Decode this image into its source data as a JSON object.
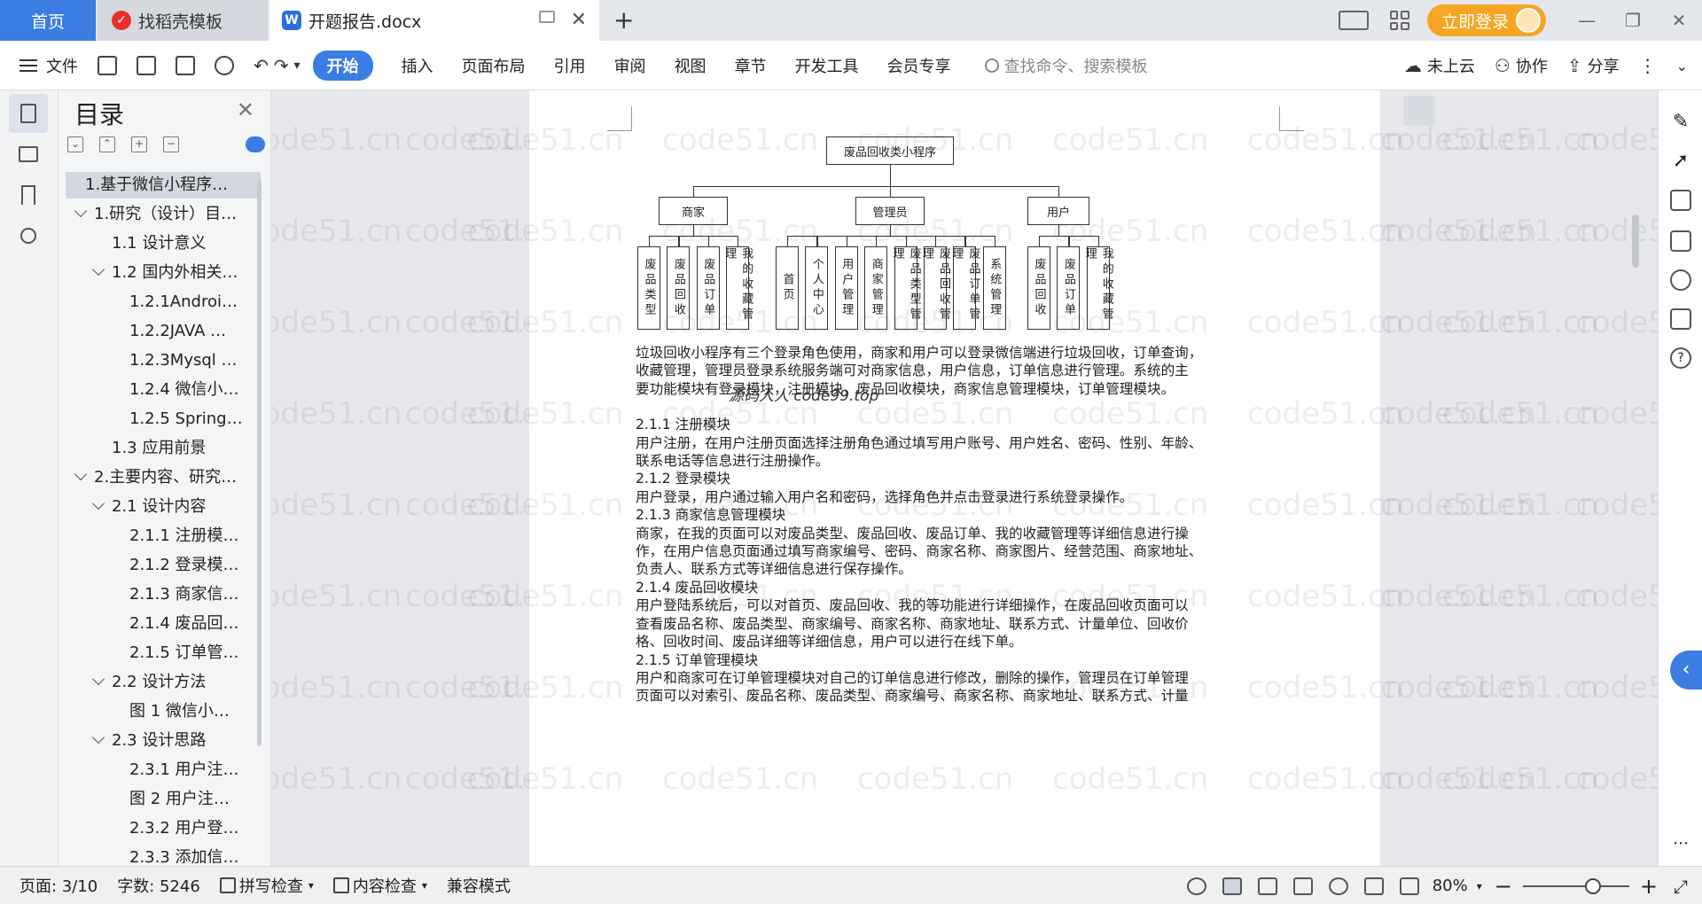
{
  "tabs": {
    "home": "首页",
    "daoke": "找稻壳模板",
    "doc": "开题报告.docx"
  },
  "titlebar": {
    "login": "立即登录"
  },
  "ribbon": {
    "file": "文件",
    "tabs": [
      "开始",
      "插入",
      "页面布局",
      "引用",
      "审阅",
      "视图",
      "章节",
      "开发工具",
      "会员专享"
    ],
    "search_placeholder": "查找命令、搜索模板",
    "cloud": "未上云",
    "collab": "协作",
    "share": "分享"
  },
  "toc": {
    "title": "目录",
    "items": [
      {
        "label": "1.基于微信小程序…",
        "level": 0,
        "caret": false,
        "selected": true
      },
      {
        "label": "1.研究（设计）目…",
        "level": 0,
        "caret": true
      },
      {
        "label": "1.1 设计意义",
        "level": 1,
        "caret": false
      },
      {
        "label": "1.2 国内外相关…",
        "level": 1,
        "caret": true
      },
      {
        "label": "1.2.1Androi…",
        "level": 2,
        "caret": false
      },
      {
        "label": "1.2.2JAVA …",
        "level": 2,
        "caret": false
      },
      {
        "label": "1.2.3Mysql …",
        "level": 2,
        "caret": false
      },
      {
        "label": "1.2.4 微信小…",
        "level": 2,
        "caret": false
      },
      {
        "label": "1.2.5 Spring…",
        "level": 2,
        "caret": false
      },
      {
        "label": "1.3 应用前景",
        "level": 1,
        "caret": false
      },
      {
        "label": "2.主要内容、研究…",
        "level": 0,
        "caret": true
      },
      {
        "label": "2.1 设计内容",
        "level": 1,
        "caret": true
      },
      {
        "label": "2.1.1 注册模…",
        "level": 2,
        "caret": false
      },
      {
        "label": "2.1.2 登录模…",
        "level": 2,
        "caret": false
      },
      {
        "label": "2.1.3 商家信…",
        "level": 2,
        "caret": false
      },
      {
        "label": "2.1.4 废品回…",
        "level": 2,
        "caret": false
      },
      {
        "label": "2.1.5 订单管…",
        "level": 2,
        "caret": false
      },
      {
        "label": "2.2 设计方法",
        "level": 1,
        "caret": true
      },
      {
        "label": "图 1 微信小…",
        "level": 2,
        "caret": false
      },
      {
        "label": "2.3 设计思路",
        "level": 1,
        "caret": true
      },
      {
        "label": "2.3.1 用户注…",
        "level": 2,
        "caret": false
      },
      {
        "label": "图 2 用户注…",
        "level": 2,
        "caret": false
      },
      {
        "label": "2.3.2 用户登…",
        "level": 2,
        "caret": false
      },
      {
        "label": "2.3.3 添加信…",
        "level": 2,
        "caret": false
      }
    ]
  },
  "diagram": {
    "root": "废品回收类小程序",
    "groups": [
      {
        "name": "商家",
        "children": [
          "废品类型",
          "废品回收",
          "废品订单",
          "我的收藏管理"
        ]
      },
      {
        "name": "管理员",
        "children": [
          "首页",
          "个人中心",
          "用户管理",
          "商家管理",
          "废品类型管理",
          "废品回收管理",
          "废品订单管理",
          "系统管理"
        ]
      },
      {
        "name": "用户",
        "children": [
          "废品回收",
          "废品订单",
          "我的收藏管理"
        ]
      }
    ]
  },
  "document": {
    "overlay_watermark": "源码人人 code99.top",
    "paragraphs": [
      "垃圾回收小程序有三个登录角色使用，商家和用户可以登录微信端进行垃圾回收，订单查询，",
      "收藏管理，管理员登录系统服务端可对商家信息，用户信息，订单信息进行管理。系统的主",
      "要功能模块有登录模块，注册模块，废品回收模块，商家信息管理模块，订单管理模块。",
      "",
      "2.1.1 注册模块",
      "用户注册，在用户注册页面选择注册角色通过填写用户账号、用户姓名、密码、性别、年龄、",
      "联系电话等信息进行注册操作。",
      "2.1.2 登录模块",
      "用户登录，用户通过输入用户名和密码，选择角色并点击登录进行系统登录操作。",
      "2.1.3 商家信息管理模块",
      "商家，在我的页面可以对废品类型、废品回收、废品订单、我的收藏管理等详细信息进行操",
      "作，在用户信息页面通过填写商家编号、密码、商家名称、商家图片、经营范围、商家地址、",
      "负责人、联系方式等详细信息进行保存操作。",
      "2.1.4 废品回收模块",
      "用户登陆系统后，可以对首页、废品回收、我的等功能进行详细操作，在废品回收页面可以",
      "查看废品名称、废品类型、商家编号、商家名称、商家地址、联系方式、计量单位、回收价",
      "格、回收时间、废品详细等详细信息，用户可以进行在线下单。",
      "2.1.5 订单管理模块",
      "用户和商家可在订单管理模块对自己的订单信息进行修改，删除的操作，管理员在订单管理",
      "页面可以对索引、废品名称、废品类型、商家编号、商家名称、商家地址、联系方式、计量"
    ]
  },
  "watermark": "code51.cn",
  "status": {
    "page": "页面: 3/10",
    "words": "字数: 5246",
    "spell": "拼写检查",
    "content_check": "内容检查",
    "compat": "兼容模式",
    "zoom": "80%"
  }
}
